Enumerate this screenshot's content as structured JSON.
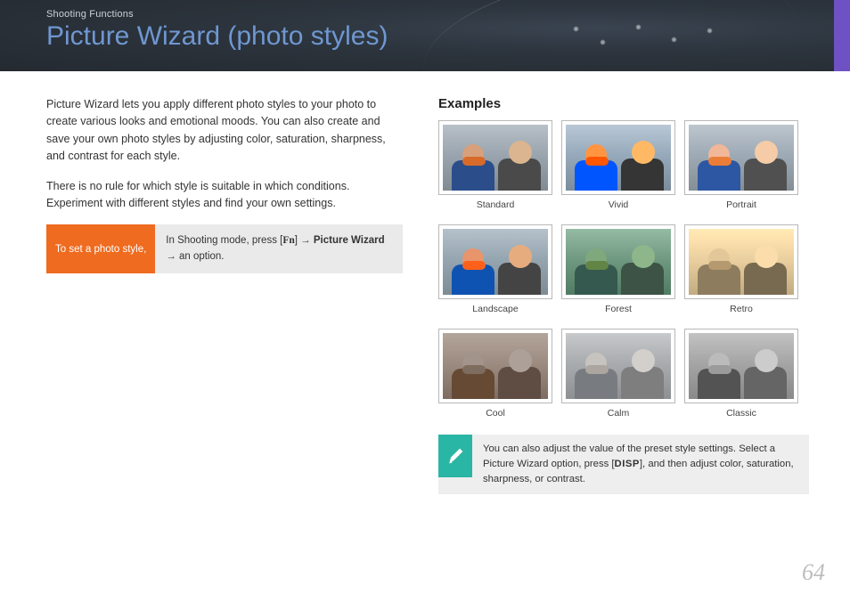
{
  "header": {
    "section": "Shooting Functions",
    "title": "Picture Wizard (photo styles)"
  },
  "intro": {
    "p1": "Picture Wizard lets you apply different photo styles to your photo to create various looks and emotional moods. You can also create and save your own photo styles by adjusting color, saturation, sharpness, and contrast for each style.",
    "p2": "There is no rule for which style is suitable in which conditions. Experiment with different styles and find your own settings."
  },
  "instruction": {
    "label": "To set a photo style,",
    "pre": "In Shooting mode, press [",
    "fn": "Fn",
    "arrow1": "] → ",
    "step": "Picture Wizard",
    "arrow2": " → an option."
  },
  "examples": {
    "heading": "Examples",
    "items": [
      {
        "label": "Standard",
        "filter": "f-standard"
      },
      {
        "label": "Vivid",
        "filter": "f-vivid"
      },
      {
        "label": "Portrait",
        "filter": "f-portrait"
      },
      {
        "label": "Landscape",
        "filter": "f-landscape"
      },
      {
        "label": "Forest",
        "filter": "f-forest"
      },
      {
        "label": "Retro",
        "filter": "f-retro"
      },
      {
        "label": "Cool",
        "filter": "f-cool"
      },
      {
        "label": "Calm",
        "filter": "f-calm"
      },
      {
        "label": "Classic",
        "filter": "f-classic"
      }
    ]
  },
  "note": {
    "pre": "You can also adjust the value of the preset style settings. Select a Picture Wizard option, press [",
    "disp": "DISP",
    "post": "], and then adjust color, saturation, sharpness, or contrast."
  },
  "page_number": "64"
}
